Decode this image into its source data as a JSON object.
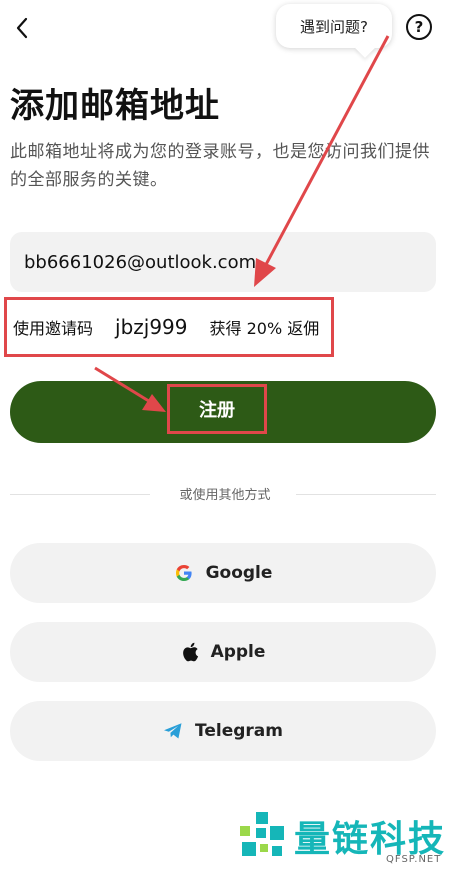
{
  "header": {
    "back_icon": "chevron-left-icon",
    "help_tooltip": "遇到问题?",
    "help_icon": "question-circle-icon",
    "help_icon_glyph": "?"
  },
  "page": {
    "title": "添加邮箱地址",
    "subtitle": "此邮箱地址将成为您的登录账号，也是您访问我们提供的全部服务的关键。"
  },
  "form": {
    "email_value": "bb6661026@outlook.com",
    "invite_label": "使用邀请码",
    "invite_code": "jbzj999",
    "invite_bonus": "获得 20% 返佣",
    "register_label": "注册"
  },
  "alternatives": {
    "divider_text": "或使用其他方式",
    "buttons": [
      {
        "label": "Google",
        "icon": "google-icon"
      },
      {
        "label": "Apple",
        "icon": "apple-icon"
      },
      {
        "label": "Telegram",
        "icon": "telegram-icon"
      }
    ]
  },
  "watermark": {
    "name": "量链科技",
    "domain": "QFSP.NET"
  },
  "colors": {
    "primary_green": "#2d5a16",
    "highlight_red": "#e0474a",
    "brand_teal": "#15b6b8"
  }
}
